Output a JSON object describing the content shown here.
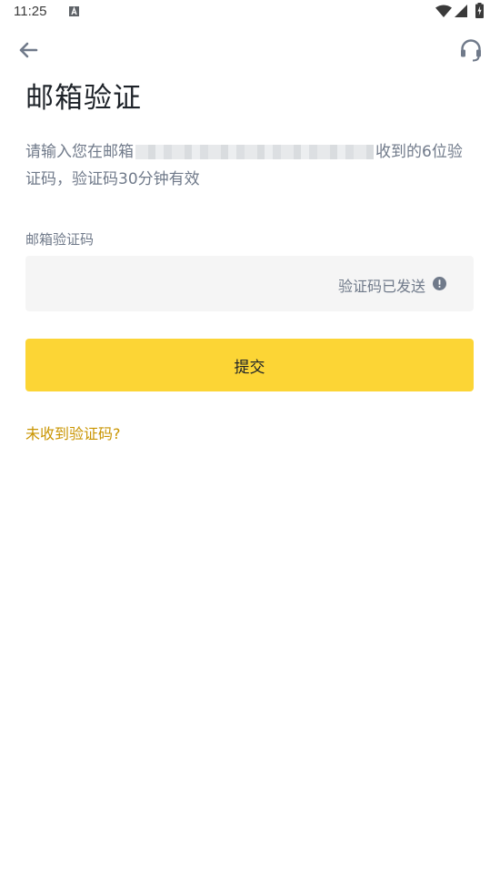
{
  "status_bar": {
    "time": "11:25",
    "notification_icon": "a-box-icon",
    "wifi_icon": "wifi-icon",
    "signal_icon": "signal-icon",
    "battery_icon": "battery-charging-icon"
  },
  "header": {
    "back_icon": "arrow-left-icon",
    "support_icon": "headset-icon",
    "title": "邮箱验证"
  },
  "description": {
    "prefix": "请输入您在邮箱",
    "suffix": "收到的6位验证码，验证码30分钟有效"
  },
  "form": {
    "field_label": "邮箱验证码",
    "input_value": "",
    "sent_status": "验证码已发送",
    "status_icon": "exclamation-circle-icon",
    "submit_label": "提交"
  },
  "help_link": "未收到验证码?",
  "colors": {
    "accent": "#fcd535",
    "link": "#c99400",
    "text_primary": "#1e2329",
    "text_secondary": "#707a8a",
    "input_bg": "#f5f5f5"
  }
}
